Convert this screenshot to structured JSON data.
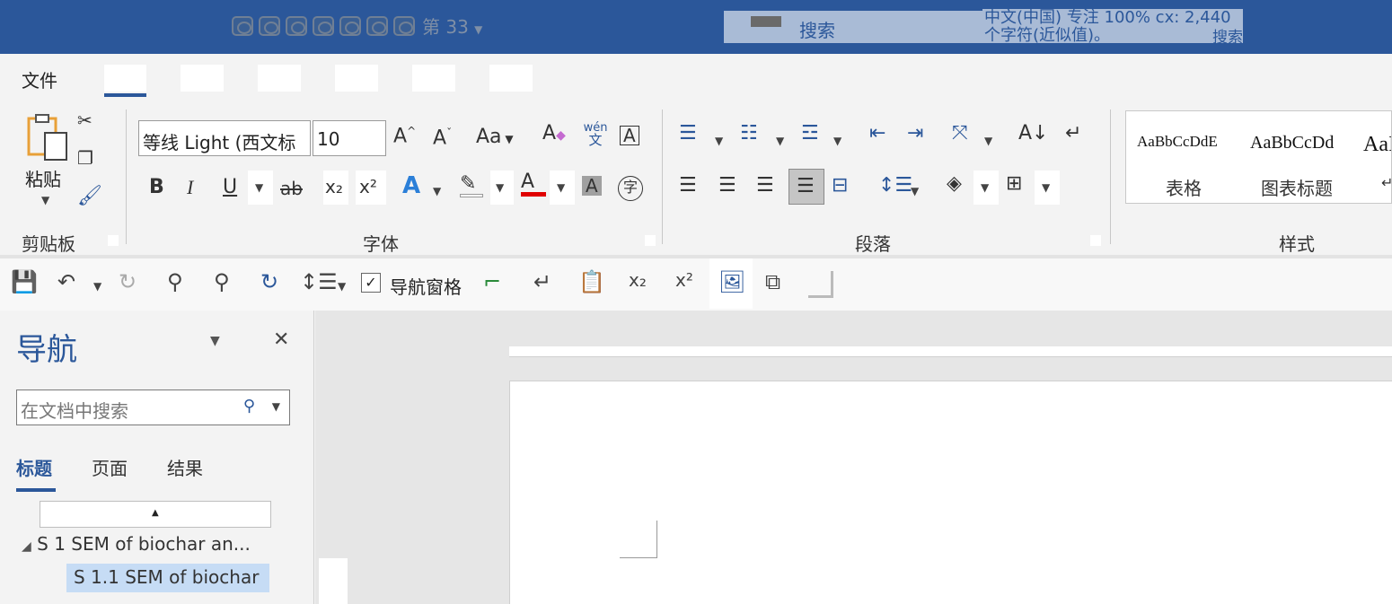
{
  "title_bar": {
    "page_indicator": "第 33",
    "search_label": "搜索",
    "lang_line1": "中文(中国) 专注 100% cx: 2,440",
    "lang_line2": "个字符(近似值)。",
    "lang_search": "搜索"
  },
  "ribbon_tabs": {
    "file": "文件"
  },
  "ribbon": {
    "clipboard": {
      "paste_label": "粘贴",
      "group_label": "剪贴板"
    },
    "font": {
      "font_name": "等线 Light (西文标",
      "font_size": "10",
      "aa_label": "Aa",
      "bold": "B",
      "italic": "I",
      "underline": "U",
      "strike": "ab",
      "sub": "x₂",
      "sup": "x²",
      "phonetic_top": "wén",
      "phonetic_bottom": "文",
      "enclose": "字",
      "group_label": "字体"
    },
    "paragraph": {
      "group_label": "段落"
    },
    "styles": {
      "items": [
        {
          "sample": "AaBbCcDdE",
          "name": "表格"
        },
        {
          "sample": "AaBbCcDd",
          "name": "图表标题"
        },
        {
          "sample": "AaI",
          "name": "↵"
        }
      ],
      "group_label": "样式"
    }
  },
  "qat": {
    "nav_pane_label": "导航窗格"
  },
  "nav_pane": {
    "title": "导航",
    "search_placeholder": "在文档中搜索",
    "tabs": [
      "标题",
      "页面",
      "结果"
    ],
    "headings": [
      {
        "text": "S 1 SEM of biochar an..."
      },
      {
        "text": "S 1.1 SEM of biochar"
      }
    ]
  },
  "colors": {
    "title_bar": "#2b579a",
    "accent": "#2b579a",
    "font_color_red": "#e00000",
    "selected_heading": "#c6dcf5"
  }
}
